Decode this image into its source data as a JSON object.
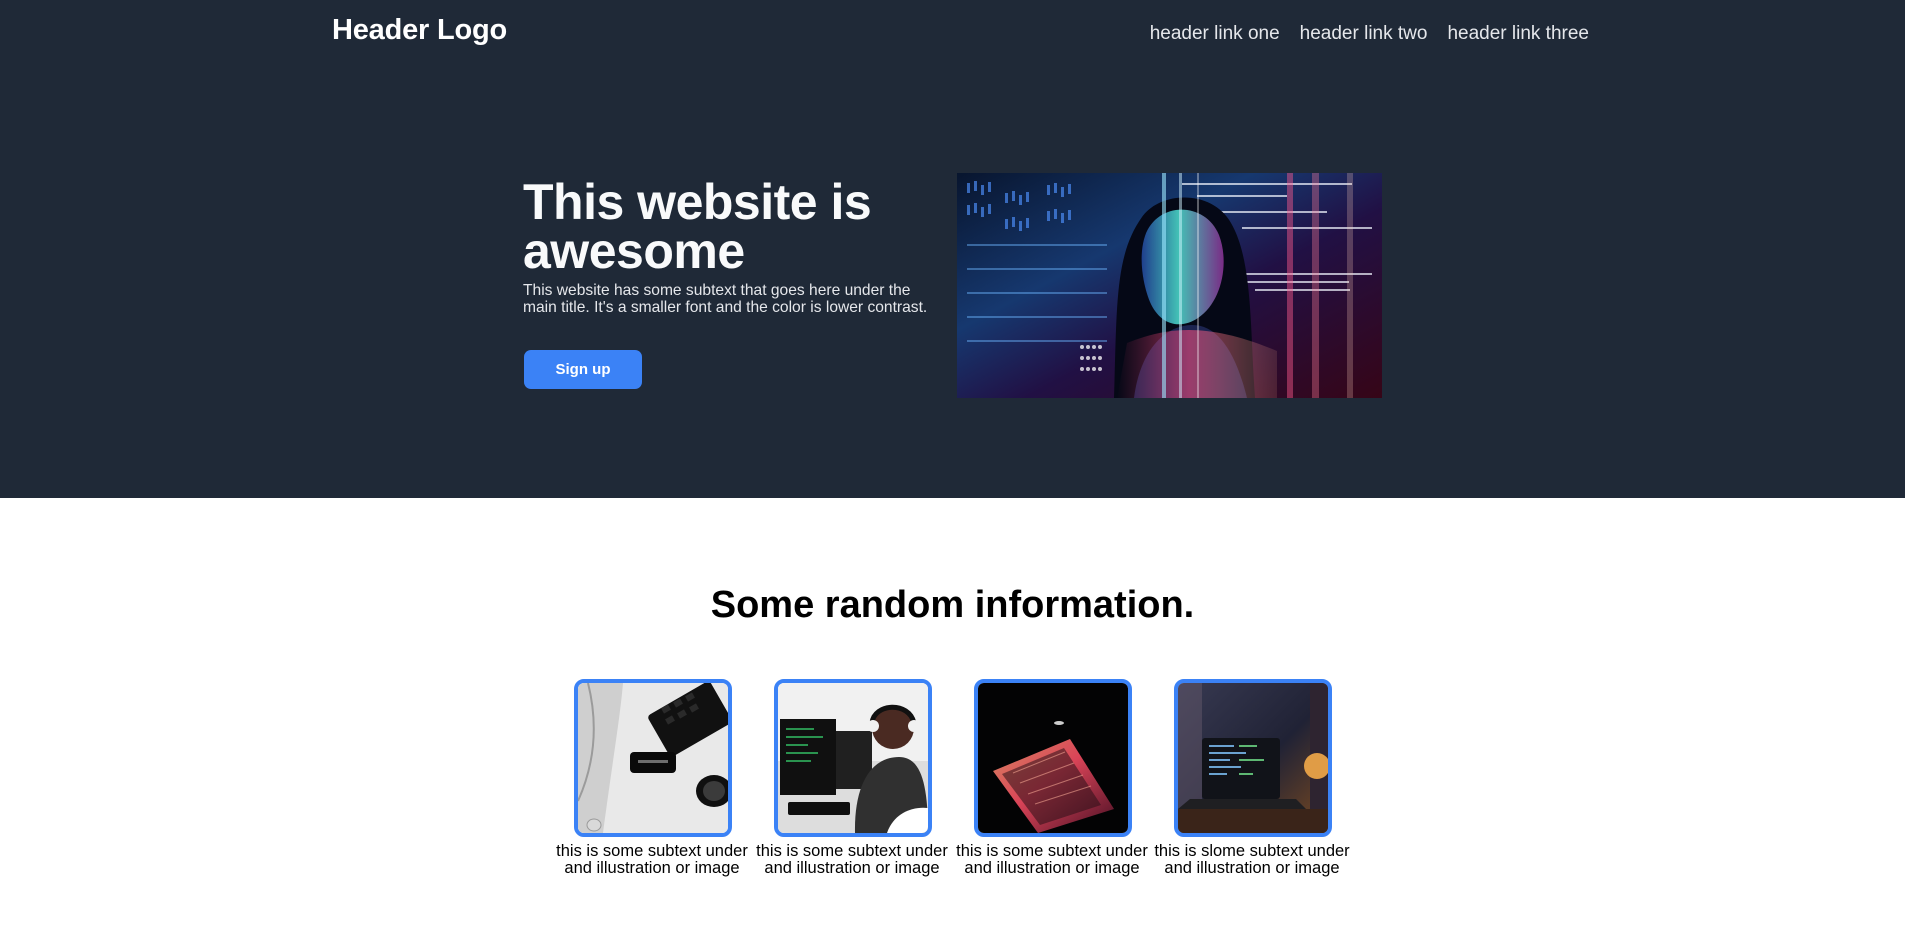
{
  "header": {
    "logo": "Header Logo",
    "links": [
      "header link one",
      "header link two",
      "header link three"
    ]
  },
  "hero": {
    "title": "This website is awesome",
    "subtext": "This website has some subtext that goes here under the main title. It's a smaller font and the color is lower contrast.",
    "signup_label": "Sign up",
    "image": {
      "description": "woman with projected code",
      "accent_colors": [
        "#4f8dff",
        "#ff4a7b",
        "#1ad6ff",
        "#ffffff"
      ]
    }
  },
  "info": {
    "title": "Some random information.",
    "cards": [
      {
        "icon": "desk-setup-image",
        "caption": "this is some subtext under and illustration or image"
      },
      {
        "icon": "developer-headphones-image",
        "caption": "this is some subtext under and illustration or image"
      },
      {
        "icon": "laptop-keyboard-image",
        "caption": "this is some subtext under and illustration or image"
      },
      {
        "icon": "laptop-code-image",
        "caption": "this is slome subtext under and illustration or image"
      }
    ]
  },
  "colors": {
    "header_bg": "#1f2937",
    "accent": "#3b82f6",
    "text_light": "#f9fafb",
    "text_muted": "#e5e7eb"
  }
}
